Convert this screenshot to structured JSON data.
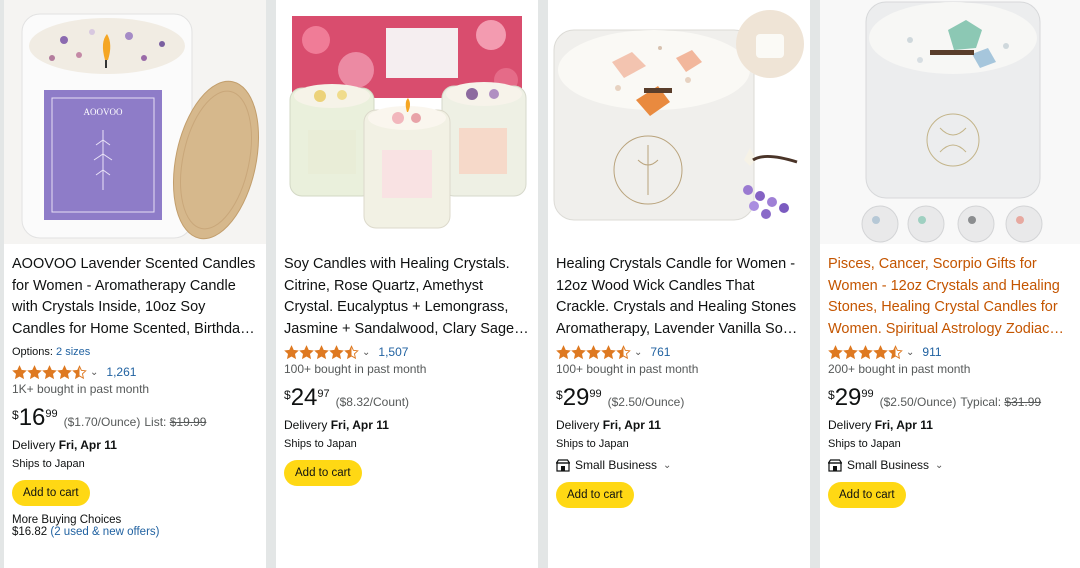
{
  "products": [
    {
      "title": "AOOVOO Lavender Scented Candles for Women - Aromatherapy Candle with Crystals Inside, 10oz Soy Candles for Home Scented, Birthday Gifts for Women, Christmas Candle",
      "brand_label": "AOOVOO",
      "options_label": "Options:",
      "options_link": "2 sizes",
      "rating": 4.5,
      "review_count": "1,261",
      "bought": "1K+ bought in past month",
      "price_currency": "$",
      "price_whole": "16",
      "price_fraction": "99",
      "unit_price": "($1.70/Ounce)",
      "list_label": "List:",
      "list_price": "$19.99",
      "delivery_label": "Delivery",
      "delivery_date": "Fri, Apr 11",
      "ships": "Ships to Japan",
      "add_to_cart": "Add to cart",
      "more_buying": "More Buying Choices",
      "more_price": "$16.82",
      "more_offers": "(2 used & new offers)"
    },
    {
      "title": "Soy Candles with Healing Crystals. Citrine, Rose Quartz, Amethyst Crystal. Eucalyptus + Lemongrass, Jasmine + Sandalwood, Clary Sage + Lavender",
      "rating": 4.5,
      "review_count": "1,507",
      "bought": "100+ bought in past month",
      "price_currency": "$",
      "price_whole": "24",
      "price_fraction": "97",
      "unit_price": "($8.32/Count)",
      "delivery_label": "Delivery",
      "delivery_date": "Fri, Apr 11",
      "ships": "Ships to Japan",
      "add_to_cart": "Add to cart"
    },
    {
      "title": "Healing Crystals Candle for Women - 12oz Wood Wick Candles That Crackle. Crystals and Healing Stones Aromatherapy, Lavender Vanilla Soy Candle",
      "rating": 4.5,
      "review_count": "761",
      "bought": "100+ bought in past month",
      "price_currency": "$",
      "price_whole": "29",
      "price_fraction": "99",
      "unit_price": "($2.50/Ounce)",
      "delivery_label": "Delivery",
      "delivery_date": "Fri, Apr 11",
      "ships": "Ships to Japan",
      "small_business": "Small Business",
      "add_to_cart": "Add to cart"
    },
    {
      "title": "Pisces, Cancer, Scorpio Gifts for Women - 12oz Crystals and Healing Stones, Healing Crystal Candles for Women. Spiritual Astrology Zodiac Candle",
      "rating": 4.5,
      "review_count": "911",
      "bought": "200+ bought in past month",
      "price_currency": "$",
      "price_whole": "29",
      "price_fraction": "99",
      "unit_price": "($2.50/Ounce)",
      "list_label": "Typical:",
      "list_price": "$31.99",
      "delivery_label": "Delivery",
      "delivery_date": "Fri, Apr 11",
      "ships": "Ships to Japan",
      "small_business": "Small Business",
      "add_to_cart": "Add to cart"
    }
  ],
  "colors": {
    "link": "#2162a1",
    "star": "#de7921",
    "button": "#ffd814",
    "title_highlight": "#c45500"
  }
}
